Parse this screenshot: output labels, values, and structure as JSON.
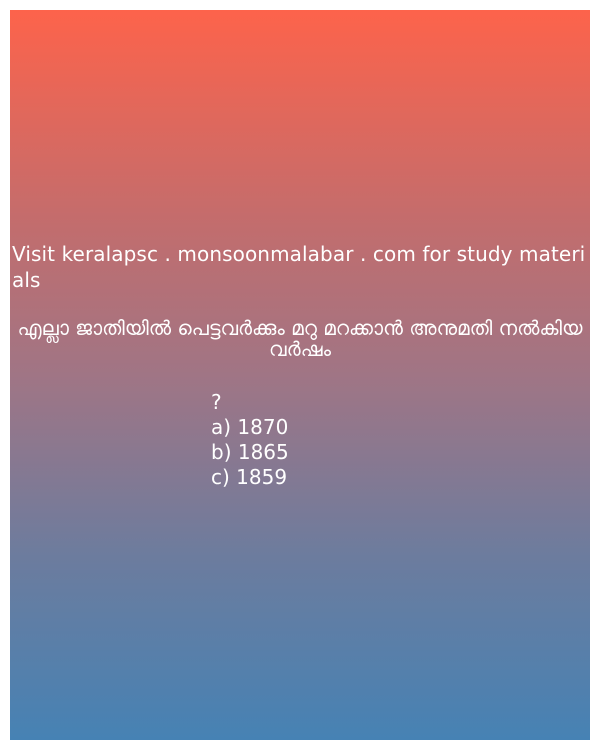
{
  "site_line": "Visit keralapsc . monsoonmalabar . com for study materials",
  "question": {
    "text": "എല്ലാ ജാതിയിൽ പെട്ടവർക്കും മറു  മറക്കാൻ അനുമതി നൽകിയ വർഷം",
    "mark": "?"
  },
  "options": [
    "a) 1870",
    "b) 1865",
    "c) 1859"
  ],
  "colors": {
    "gradient_top": "#fd634b",
    "gradient_bottom": "#4682b4",
    "text": "#ffffff"
  }
}
